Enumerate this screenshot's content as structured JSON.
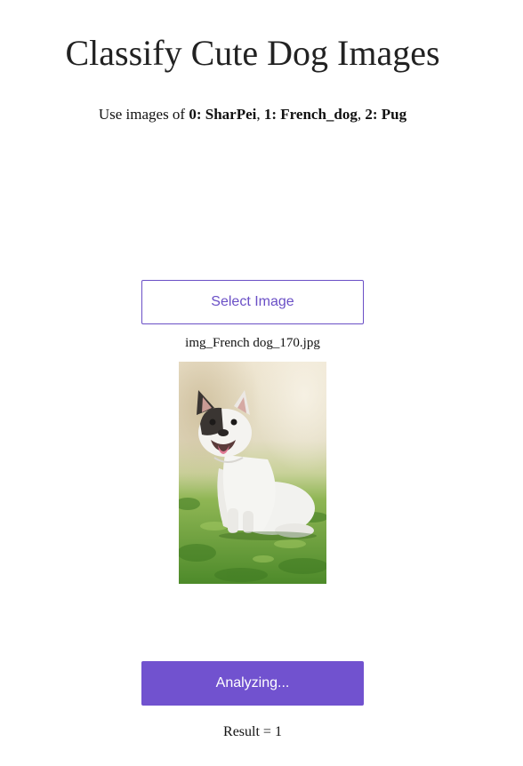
{
  "header": {
    "title": "Classify Cute Dog Images",
    "subtitle_prefix": "Use images of ",
    "classes": [
      {
        "label": "0: SharPei"
      },
      {
        "label": "1: French_dog"
      },
      {
        "label": "2: Pug"
      }
    ],
    "separator": ", "
  },
  "upload": {
    "select_label": "Select Image",
    "filename": "img_French dog_170.jpg"
  },
  "analyze": {
    "button_label": "Analyzing...",
    "result_text": "Result = 1"
  },
  "colors": {
    "accent": "#7152cf",
    "accent_border": "#6a4fc6"
  }
}
